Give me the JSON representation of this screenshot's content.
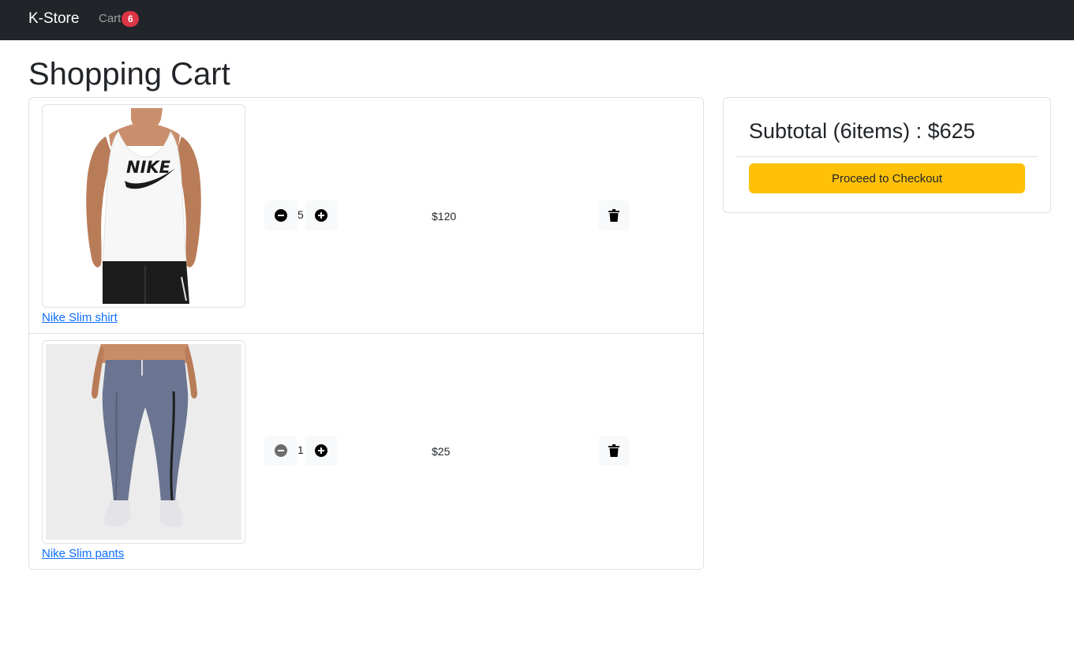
{
  "navbar": {
    "brand": "K-Store",
    "cart_label": "Cart",
    "cart_count": "6"
  },
  "page": {
    "title": "Shopping Cart"
  },
  "cart": {
    "items": [
      {
        "name": "Nike Slim shirt",
        "quantity": "5",
        "price": "$120"
      },
      {
        "name": "Nike Slim pants",
        "quantity": "1",
        "price": "$25"
      }
    ]
  },
  "summary": {
    "subtotal_text": "Subtotal (6items) : $625",
    "checkout_label": "Proceed to Checkout"
  },
  "colors": {
    "navbar_bg": "#212529",
    "badge_bg": "#dc3545",
    "link": "#0d6efd",
    "checkout_bg": "#ffc107"
  }
}
